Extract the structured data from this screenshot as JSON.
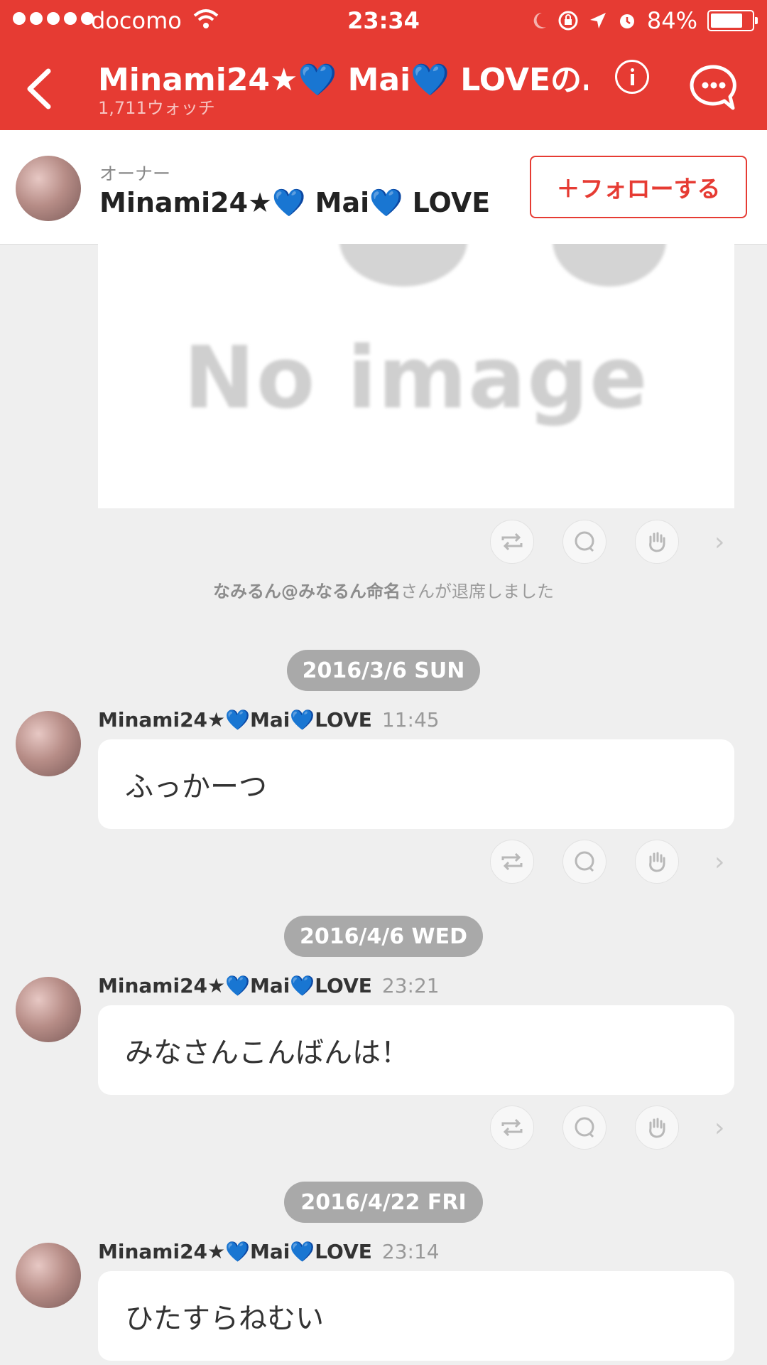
{
  "status_bar": {
    "carrier": "docomo",
    "time": "23:34",
    "battery": "84%",
    "battery_level": 0.84
  },
  "header": {
    "title": "Minami24★💙 Mai💙 LOVEの…",
    "subtitle": "1,711ウォッチ"
  },
  "owner": {
    "label": "オーナー",
    "name": "Minami24★💙 Mai💙 LOVE",
    "follow_label": "＋フォローする"
  },
  "image_placeholder_text": "No image",
  "system_message": {
    "user": "なみるん@みなるん命名",
    "text": "さんが退席しました"
  },
  "messages": [
    {
      "date": "2016/3/6 SUN",
      "author": "Minami24★💙Mai💙LOVE",
      "time": "11:45",
      "text": "ふっかーつ"
    },
    {
      "date": "2016/4/6 WED",
      "author": "Minami24★💙Mai💙LOVE",
      "time": "23:21",
      "text": "みなさんこんばんは！"
    },
    {
      "date": "2016/4/22 FRI",
      "author": "Minami24★💙Mai💙LOVE",
      "time": "23:14",
      "text": "ひたすらねむい"
    }
  ],
  "icons": {
    "repost": "repost-icon",
    "comment": "comment-icon",
    "applause": "clap-icon",
    "more": "chevron-right-icon"
  },
  "colors": {
    "accent": "#e63b33",
    "background": "#efefef",
    "date_pill": "#a9a9a9"
  }
}
